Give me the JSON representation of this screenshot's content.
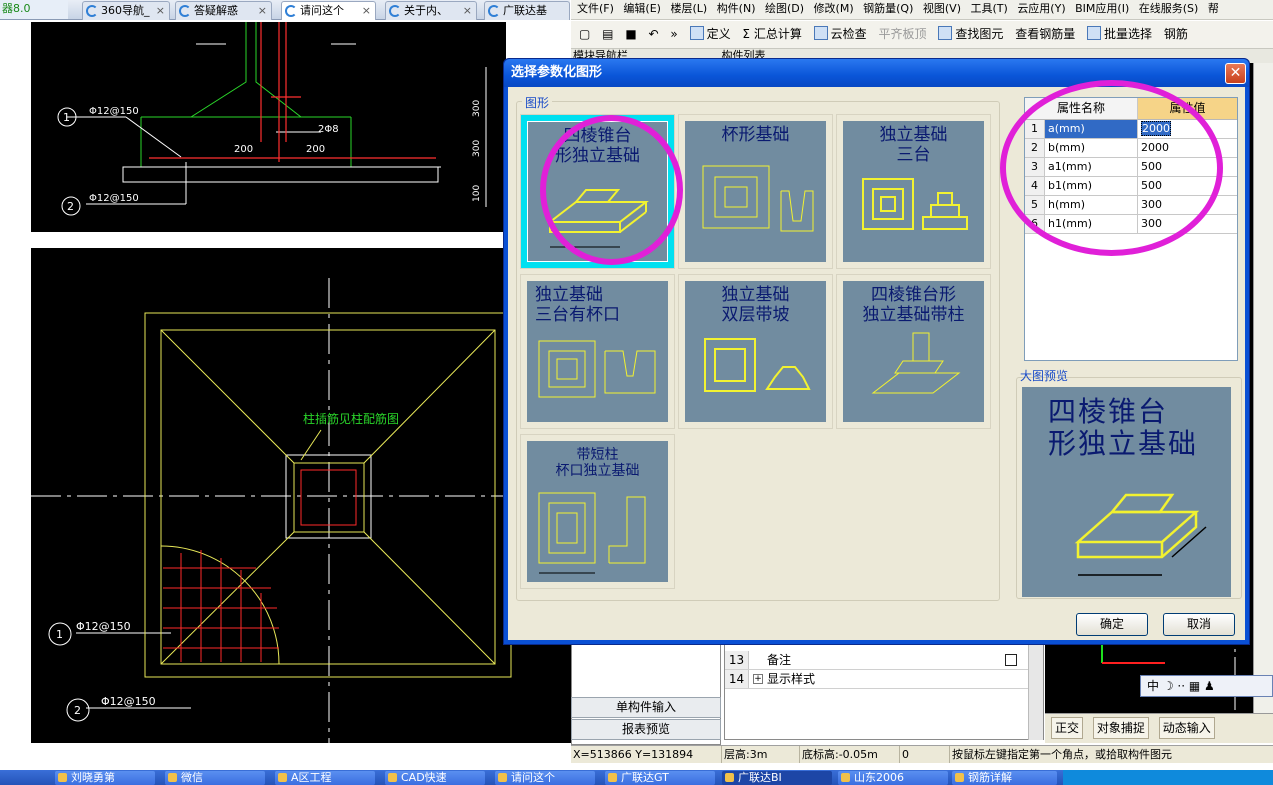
{
  "browser": {
    "app_title": "器8.0",
    "tabs": [
      {
        "label": "360导航_"
      },
      {
        "label": "答疑解惑"
      },
      {
        "label": "请问这个"
      },
      {
        "label": "关于内、"
      },
      {
        "label": "广联达基"
      }
    ],
    "close_glyph": "×"
  },
  "cad": {
    "top_labels": {
      "rebar_1": "Φ12@150",
      "rebar_2": "Φ12@150",
      "num_1": "1",
      "num_2": "2",
      "dim_200_a": "200",
      "dim_200_b": "200",
      "stirrup": "2Φ8",
      "dim_300_a": "300",
      "dim_300_b": "300",
      "dim_100": "100"
    },
    "bottom_labels": {
      "note": "柱插筋见柱配筋图",
      "rebar_1": "Φ12@150",
      "rebar_2": "Φ12@150",
      "num_1": "1",
      "num_2": "2"
    }
  },
  "menu": {
    "items": [
      "文件(F)",
      "编辑(E)",
      "楼层(L)",
      "构件(N)",
      "绘图(D)",
      "修改(M)",
      "钢筋量(Q)",
      "视图(V)",
      "工具(T)",
      "云应用(Y)",
      "BIM应用(I)",
      "在线服务(S)",
      "帮"
    ]
  },
  "toolbar": {
    "define": "定义",
    "summary": "汇总计算",
    "cloud_check": "云检查",
    "flat_slab": "平齐板顶",
    "find": "查找图元",
    "view_rebar": "查看钢筋量",
    "batch_select": "批量选择",
    "rebar": "钢筋",
    "more": "»"
  },
  "subbar": {
    "module_nav": "模块导航栏",
    "component_list": "构件列表"
  },
  "dialog": {
    "title": "选择参数化图形",
    "close_label": "✕",
    "group_label": "图形",
    "shapes": [
      {
        "caption_1": "四棱锥台",
        "caption_2": "形独立基础",
        "selected": true
      },
      {
        "caption_1": "杯形基础",
        "caption_2": "",
        "selected": false
      },
      {
        "caption_1": "独立基础",
        "caption_2": "三台",
        "selected": false
      },
      {
        "caption_1": "独立基础",
        "caption_2": "三台有杯口",
        "selected": false
      },
      {
        "caption_1": "独立基础",
        "caption_2": "双层带坡",
        "selected": false
      },
      {
        "caption_1": "四棱锥台形",
        "caption_2": "独立基础带柱",
        "selected": false
      },
      {
        "caption_1": "带短柱",
        "caption_2": "杯口独立基础",
        "selected": false
      }
    ],
    "props": {
      "col_name": "属性名称",
      "col_value": "属性值",
      "rows": [
        {
          "n": "1",
          "name": "a(mm)",
          "value": "2000"
        },
        {
          "n": "2",
          "name": "b(mm)",
          "value": "2000"
        },
        {
          "n": "3",
          "name": "a1(mm)",
          "value": "500"
        },
        {
          "n": "4",
          "name": "b1(mm)",
          "value": "500"
        },
        {
          "n": "5",
          "name": "h(mm)",
          "value": "300"
        },
        {
          "n": "6",
          "name": "h1(mm)",
          "value": "300"
        }
      ]
    },
    "preview_label": "大图预览",
    "preview_caption_1": "四棱锥台",
    "preview_caption_2": "形独立基础",
    "ok": "确定",
    "cancel": "取消"
  },
  "left_panel": {
    "single_input": "单构件输入",
    "report_preview": "报表预览"
  },
  "prop_grid": {
    "rows": [
      {
        "n": "13",
        "label": "备注"
      },
      {
        "n": "14",
        "label": "显示样式"
      }
    ]
  },
  "snap": {
    "ortho": "正交",
    "object_snap": "对象捕捉",
    "dynamic_input": "动态输入"
  },
  "ime": "中",
  "status": {
    "coords": "X=513866 Y=131894",
    "floor_height": "层高:3m",
    "base_elev": "底标高:-0.05m",
    "zero": "0",
    "hint": "按鼠标左键指定第一个角点，或拾取构件图元"
  },
  "taskbar": {
    "items": [
      "刘晓勇第",
      "微信",
      "A区工程",
      "CAD快速",
      "请问这个",
      "广联达GT",
      "广联达BI",
      "山东2006",
      "钢筋详解"
    ]
  },
  "colors": {
    "highlight": "#e020d8",
    "dialog_blue": "#0a50d4",
    "preview_bg": "#718ca0"
  }
}
